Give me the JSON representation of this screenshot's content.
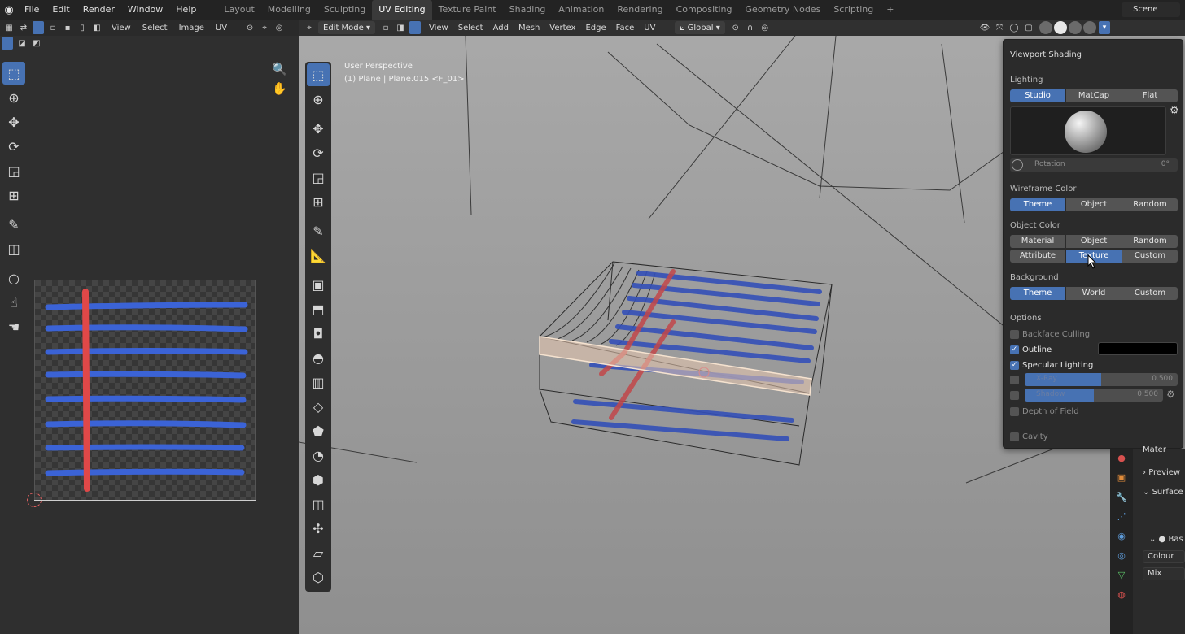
{
  "app": {
    "menus": [
      "File",
      "Edit",
      "Render",
      "Window",
      "Help"
    ],
    "workspaces": [
      "Layout",
      "Modelling",
      "Sculpting",
      "UV Editing",
      "Texture Paint",
      "Shading",
      "Animation",
      "Rendering",
      "Compositing",
      "Geometry Nodes",
      "Scripting",
      "+"
    ],
    "active_workspace": "UV Editing",
    "scene": "Scene"
  },
  "uv_editor": {
    "header_menus": [
      "View",
      "Select",
      "Image",
      "UV"
    ],
    "tools": [
      "select-box-icon",
      "cursor-icon",
      "move-icon",
      "rotate-icon",
      "scale-icon",
      "transform-icon",
      "annotate-icon",
      "rip-icon",
      "grab-icon",
      "relax-icon",
      "pinch-icon"
    ],
    "accent": "#4772b3",
    "stroke_colors": {
      "red": "#e04848",
      "blue": "#3b63d6"
    }
  },
  "viewport": {
    "mode": "Edit Mode",
    "header_menus": [
      "View",
      "Select",
      "Add",
      "Mesh",
      "Vertex",
      "Edge",
      "Face",
      "UV"
    ],
    "transform_orientation": "Global",
    "info_line1": "User Perspective",
    "info_line2": "(1) Plane | Plane.015 <F_01>"
  },
  "shading_popover": {
    "title": "Viewport Shading",
    "lighting_label": "Lighting",
    "lighting_options": [
      "Studio",
      "MatCap",
      "Flat"
    ],
    "lighting_selected": "Studio",
    "rotation_label": "Rotation",
    "rotation_value": "0°",
    "wireframe_label": "Wireframe Color",
    "wireframe_options": [
      "Theme",
      "Object",
      "Random"
    ],
    "wireframe_selected": "Theme",
    "object_color_label": "Object Color",
    "object_color_row1": [
      "Material",
      "Object",
      "Random"
    ],
    "object_color_row2": [
      "Attribute",
      "Texture",
      "Custom"
    ],
    "object_color_selected": "Texture",
    "background_label": "Background",
    "background_options": [
      "Theme",
      "World",
      "Custom"
    ],
    "background_selected": "Theme",
    "options_label": "Options",
    "backface_culling": "Backface Culling",
    "outline": "Outline",
    "specular": "Specular Lighting",
    "xray": "X-Ray",
    "xray_value": "0.500",
    "xray_fill": 0.5,
    "shadow": "Shadow",
    "shadow_value": "0.500",
    "shadow_fill": 0.5,
    "dof": "Depth of Field",
    "cavity": "Cavity",
    "outline_color": "#000000"
  },
  "properties": {
    "material_slot": "Mater",
    "preview": "Preview",
    "surface": "Surface",
    "base": "Bas",
    "colour": "Colour",
    "mix": "Mix"
  }
}
